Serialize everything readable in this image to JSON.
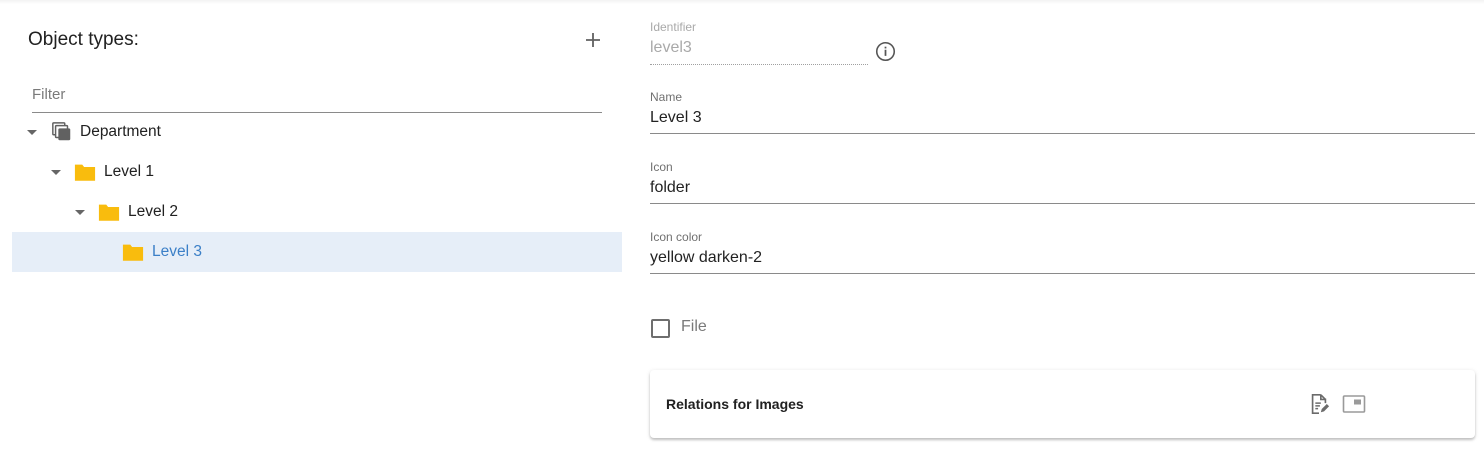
{
  "left_panel": {
    "title": "Object types:",
    "add_icon": "plus-icon",
    "filter": {
      "placeholder": "Filter",
      "value": ""
    },
    "tree": [
      {
        "label": "Department",
        "icon": "library-icon",
        "expanded": true,
        "selected": false,
        "depth": 0
      },
      {
        "label": "Level 1",
        "icon": "folder-icon",
        "icon_color": "#F9BC0D",
        "expanded": true,
        "selected": false,
        "depth": 1
      },
      {
        "label": "Level 2",
        "icon": "folder-icon",
        "icon_color": "#F9BC0D",
        "expanded": true,
        "selected": false,
        "depth": 2
      },
      {
        "label": "Level 3",
        "icon": "folder-icon",
        "icon_color": "#F9BC0D",
        "expanded": false,
        "selected": true,
        "depth": 3
      }
    ]
  },
  "form": {
    "identifier": {
      "label": "Identifier",
      "value": "level3",
      "disabled": true,
      "info_icon": "info-icon"
    },
    "name": {
      "label": "Name",
      "value": "Level 3"
    },
    "icon": {
      "label": "Icon",
      "value": "folder"
    },
    "icon_color": {
      "label": "Icon color",
      "value": "yellow darken-2"
    },
    "file_checkbox": {
      "label": "File",
      "checked": false
    }
  },
  "relations_card": {
    "title": "Relations for Images",
    "actions": [
      "edit-document-icon",
      "toggle-view-icon"
    ]
  },
  "colors": {
    "accent": "#3B7FC7",
    "selection_bg": "#E6EEF8",
    "folder": "#F9BC0D"
  }
}
